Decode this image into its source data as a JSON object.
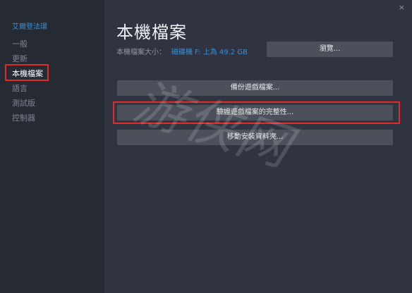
{
  "sidebar": {
    "game_title": "艾爾登法環",
    "items": [
      {
        "label": "一般"
      },
      {
        "label": "更新"
      },
      {
        "label": "本機檔案"
      },
      {
        "label": "語言"
      },
      {
        "label": "測試版"
      },
      {
        "label": "控制器"
      }
    ]
  },
  "main": {
    "title": "本機檔案",
    "size_label": "本機檔案大小：",
    "size_value": "磁碟機 F: 上為 49.2 GB",
    "browse_label": "瀏覽...",
    "backup_label": "備份遊戲檔案...",
    "verify_label": "驗證遊戲檔案的完整性...",
    "move_label": "移動安裝資料夾..."
  },
  "watermark": {
    "text": "游侠网"
  },
  "close_glyph": "×",
  "colors": {
    "sidebar_bg": "#262a33",
    "main_bg": "#2f3440",
    "button_bg": "#4b505b",
    "accent_blue": "#3a8fd6",
    "highlight_red": "#e22a2a"
  }
}
